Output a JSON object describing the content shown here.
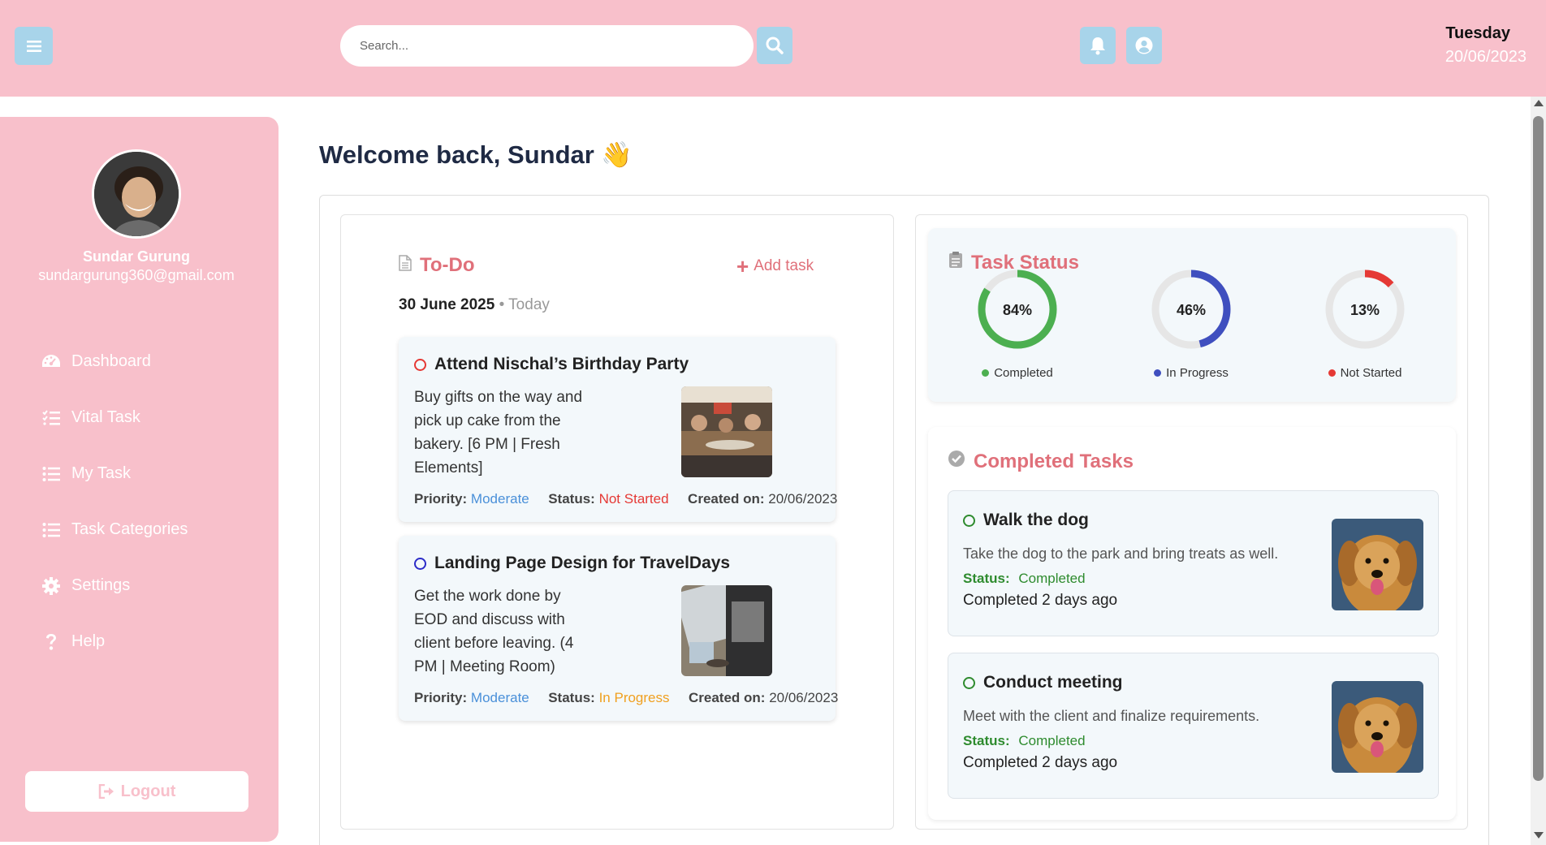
{
  "header": {
    "search_placeholder": "Search...",
    "day": "Tuesday",
    "date": "20/06/2023"
  },
  "sidebar": {
    "user_name": "Sundar Gurung",
    "user_email": "sundargurung360@gmail.com",
    "items": [
      {
        "label": "Dashboard",
        "icon": "dashboard-icon"
      },
      {
        "label": "Vital Task",
        "icon": "vital-task-icon"
      },
      {
        "label": "My Task",
        "icon": "list-icon"
      },
      {
        "label": "Task Categories",
        "icon": "list-icon"
      },
      {
        "label": "Settings",
        "icon": "gear-icon"
      },
      {
        "label": "Help",
        "icon": "question-icon"
      }
    ],
    "logout_label": "Logout"
  },
  "main": {
    "welcome": "Welcome back, Sundar 👋",
    "todo": {
      "title": "To-Do",
      "add_task": "Add task",
      "date": "30 June 2025",
      "date_suffix": "• Today",
      "tasks": [
        {
          "title": "Attend Nischal’s Birthday Party",
          "description": "Buy gifts on the way and pick up cake from the bakery. [6 PM | Fresh Elements]",
          "priority_label": "Priority:",
          "priority": "Moderate",
          "status_label": "Status:",
          "status": "Not Started",
          "created_label": "Created on:",
          "created": "20/06/2023"
        },
        {
          "title": "Landing Page Design for TravelDays",
          "description": "Get the work done by EOD and discuss with client before leaving. (4 PM | Meeting Room)",
          "priority_label": "Priority:",
          "priority": "Moderate",
          "status_label": "Status:",
          "status": "In Progress",
          "created_label": "Created on:",
          "created": "20/06/2023"
        }
      ]
    },
    "task_status": {
      "title": "Task Status",
      "rings": [
        {
          "pct": "84%",
          "value": 84,
          "label": "Completed",
          "color": "#4caf50"
        },
        {
          "pct": "46%",
          "value": 46,
          "label": "In Progress",
          "color": "#3f4fbf"
        },
        {
          "pct": "13%",
          "value": 13,
          "label": "Not Started",
          "color": "#e53935"
        }
      ]
    },
    "completed": {
      "title": "Completed Tasks",
      "tasks": [
        {
          "title": "Walk the dog",
          "description": "Take the dog to the park and bring treats as well.",
          "status_label": "Status:",
          "status": "Completed",
          "when": "Completed 2 days ago"
        },
        {
          "title": "Conduct meeting",
          "description": "Meet with the client and finalize requirements.",
          "status_label": "Status:",
          "status": "Completed",
          "when": "Completed 2 days ago"
        }
      ]
    }
  },
  "colors": {
    "brand_pink": "#f8c0cb",
    "accent_blue": "#a8d4ea",
    "heading_red": "#e0707a",
    "moderate": "#4a90d9",
    "not_started": "#e53935",
    "in_progress": "#f0a020",
    "completed_green": "#2e8b2e"
  }
}
